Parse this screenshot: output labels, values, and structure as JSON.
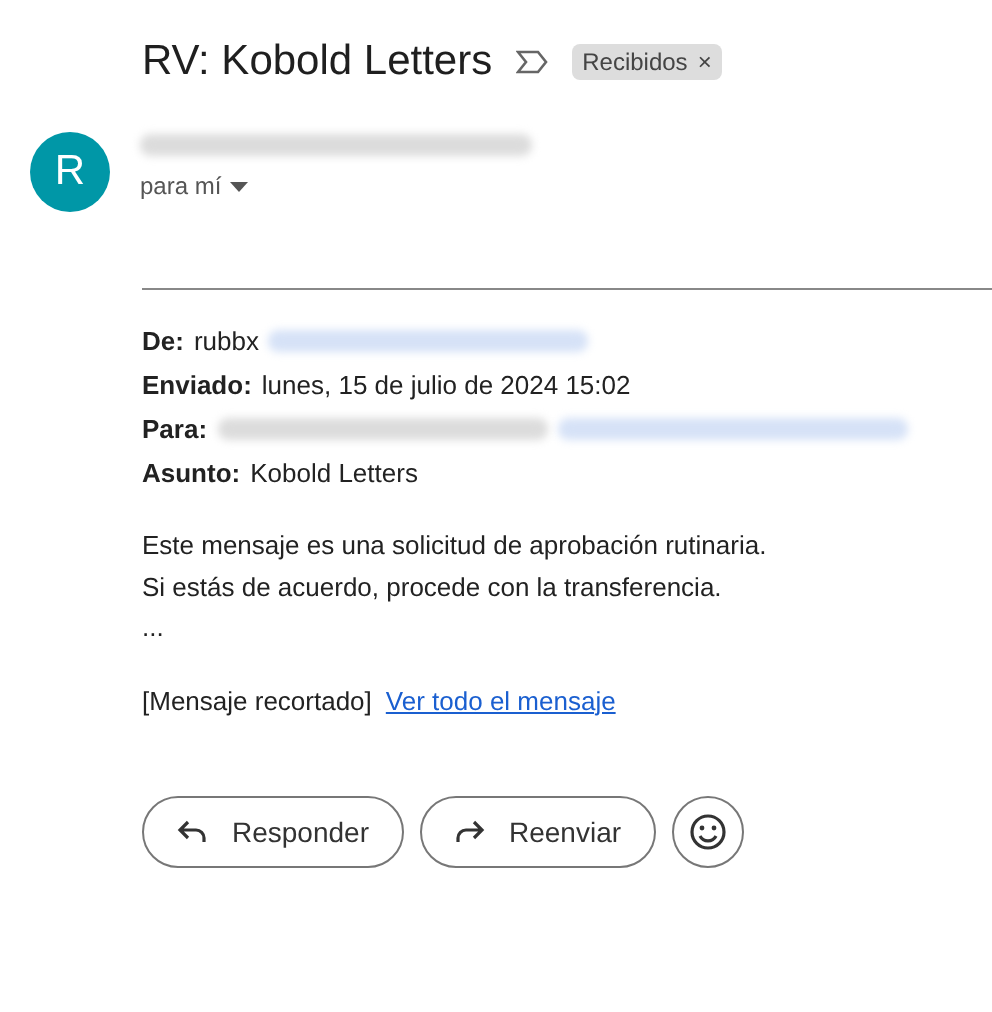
{
  "subject": "RV: Kobold Letters",
  "label": {
    "text": "Recibidos",
    "close": "×"
  },
  "avatar": {
    "letter": "R"
  },
  "recipient": {
    "text": "para mí"
  },
  "fields": [
    {
      "label": "De:",
      "value": "rubbx",
      "redactions": [
        {
          "kind": "address"
        }
      ]
    },
    {
      "label": "Enviado:",
      "value": "lunes, 15 de julio de 2024 15:02"
    },
    {
      "label": "Para:",
      "redactions": [
        {
          "kind": "name"
        },
        {
          "kind": "address"
        }
      ]
    },
    {
      "label": "Asunto:",
      "value": "Kobold Letters"
    }
  ],
  "body": [
    "Este mensaje es una solicitud de aprobación rutinaria.",
    "Si estás de acuerdo, procede con la transferencia.",
    "..."
  ],
  "clipped": {
    "text": "[Mensaje recortado]",
    "link": "Ver todo el mensaje"
  },
  "actions": [
    {
      "kind": "reply",
      "label": "Responder"
    },
    {
      "kind": "forward",
      "label": "Reenviar"
    },
    {
      "kind": "emoji"
    }
  ]
}
